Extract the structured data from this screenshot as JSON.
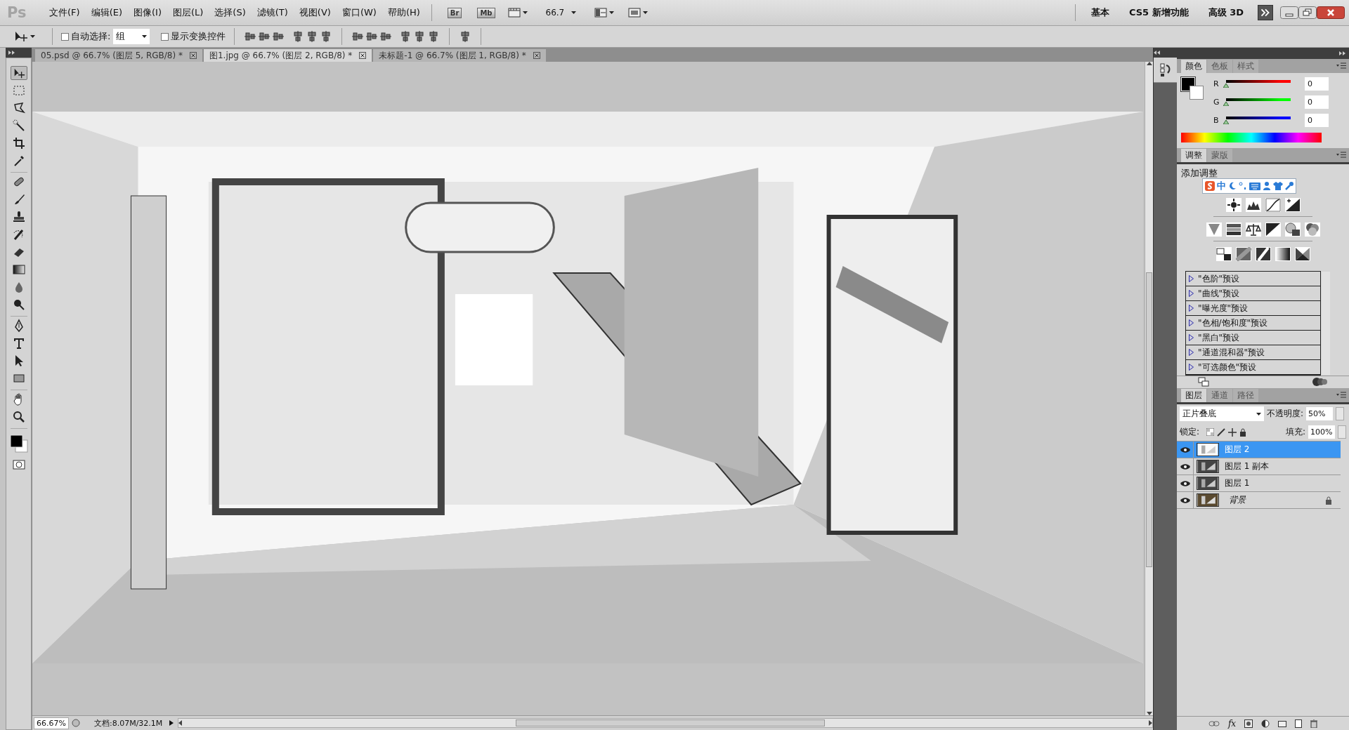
{
  "app_logo": "Ps",
  "menu": [
    "文件(F)",
    "编辑(E)",
    "图像(I)",
    "图层(L)",
    "选择(S)",
    "滤镜(T)",
    "视图(V)",
    "窗口(W)",
    "帮助(H)"
  ],
  "app_bar": {
    "bridge": "Br",
    "mini_bridge": "Mb",
    "zoom": "66.7"
  },
  "workspaces": [
    "基本",
    "CS5 新增功能",
    "高级 3D"
  ],
  "options_bar": {
    "auto_select": {
      "label": "自动选择:",
      "checked": false
    },
    "auto_select_target": "组",
    "show_transform": {
      "label": "显示变换控件",
      "checked": false
    }
  },
  "document_tabs": [
    {
      "label": "05.psd @ 66.7% (图层 5, RGB/8) *",
      "selected": false
    },
    {
      "label": "图1.jpg @ 66.7% (图层 2, RGB/8) *",
      "selected": true
    },
    {
      "label": "未标题-1 @ 66.7% (图层 1, RGB/8) *",
      "selected": false
    }
  ],
  "tool_groups": [
    {
      "tools": [
        {
          "kind": "move",
          "selected": true
        },
        {
          "kind": "marquee",
          "selected": false
        },
        {
          "kind": "lasso",
          "selected": false
        },
        {
          "kind": "wand",
          "selected": false
        },
        {
          "kind": "crop",
          "selected": false
        },
        {
          "kind": "eyedropper",
          "selected": false
        }
      ]
    },
    {
      "tools": [
        {
          "kind": "heal",
          "selected": false
        },
        {
          "kind": "brush",
          "selected": false
        },
        {
          "kind": "stamp",
          "selected": false
        },
        {
          "kind": "history",
          "selected": false
        },
        {
          "kind": "eraser",
          "selected": false
        },
        {
          "kind": "gradient",
          "selected": false
        },
        {
          "kind": "blur",
          "selected": false
        },
        {
          "kind": "dodge",
          "selected": false
        }
      ]
    },
    {
      "tools": [
        {
          "kind": "pen",
          "selected": false
        },
        {
          "kind": "type",
          "selected": false
        },
        {
          "kind": "path",
          "selected": false
        },
        {
          "kind": "shape",
          "selected": false
        }
      ]
    },
    {
      "tools": [
        {
          "kind": "hand",
          "selected": false
        },
        {
          "kind": "zoom",
          "selected": false
        }
      ]
    }
  ],
  "color_panel": {
    "tabs": [
      {
        "label": "颜色",
        "selected": true
      },
      {
        "label": "色板",
        "selected": false
      },
      {
        "label": "样式",
        "selected": false
      }
    ],
    "channels": [
      {
        "label": "R",
        "color": "#ff0000",
        "level": 0,
        "value": "0"
      },
      {
        "label": "G",
        "color": "#00ff00",
        "level": 0,
        "value": "0"
      },
      {
        "label": "B",
        "color": "#0000ff",
        "level": 0,
        "value": "0"
      }
    ]
  },
  "adjustments_panel": {
    "tabs": [
      {
        "label": "调整",
        "selected": true
      },
      {
        "label": "蒙版",
        "selected": false
      }
    ],
    "title": "添加调整",
    "presets": [
      "\"色阶\"预设",
      "\"曲线\"预设",
      "\"曝光度\"预设",
      "\"色相/饱和度\"预设",
      "\"黑白\"预设",
      "\"通道混和器\"预设",
      "\"可选颜色\"预设"
    ]
  },
  "input_method_bar": {
    "mode": "中"
  },
  "layers_panel": {
    "tabs": [
      {
        "label": "图层",
        "selected": true
      },
      {
        "label": "通道",
        "selected": false
      },
      {
        "label": "路径",
        "selected": false
      }
    ],
    "blend_mode": "正片叠底",
    "opacity_label": "不透明度:",
    "opacity": "50%",
    "lock_label": "锁定:",
    "fill_label": "填充:",
    "fill": "100%",
    "layers": [
      {
        "name": "图层 2",
        "kind": "layer",
        "selected": true,
        "visible": true,
        "locked": false
      },
      {
        "name": "图层 1 副本",
        "kind": "layer",
        "selected": false,
        "visible": true,
        "locked": false
      },
      {
        "name": "图层 1",
        "kind": "layer",
        "selected": false,
        "visible": true,
        "locked": false
      },
      {
        "name": "背景",
        "kind": "background",
        "selected": false,
        "visible": true,
        "locked": true
      }
    ],
    "fx_label": "fx"
  },
  "status_bar": {
    "zoom": "66.67%",
    "document": "文档:8.07M/32.1M"
  }
}
